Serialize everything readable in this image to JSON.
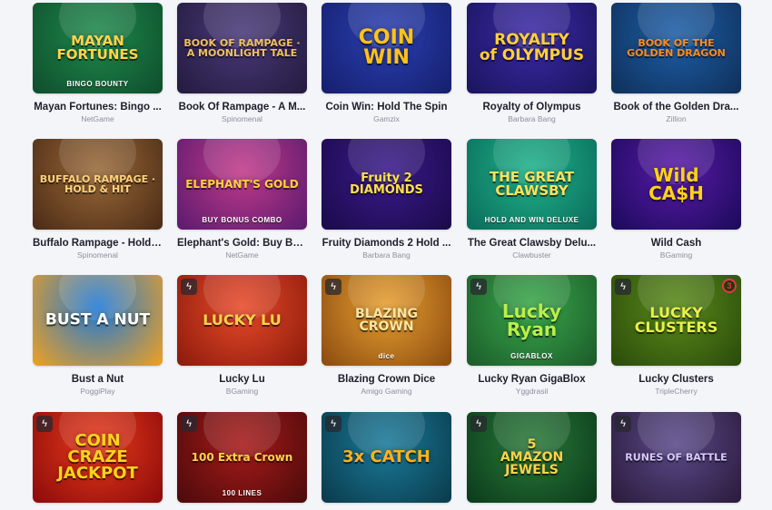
{
  "games": [
    {
      "name": "Mayan Fortunes: Bingo ...",
      "provider": "NetGame",
      "art_title": "MAYAN\nFORTUNES",
      "art_subtitle": "BINGO BOUNTY",
      "badge": false,
      "bg": [
        "#1f8a4c",
        "#0e4d2c"
      ],
      "title_color": "#ffd54a"
    },
    {
      "name": "Book Of Rampage - A M...",
      "provider": "Spinomenal",
      "art_title": "",
      "art_subtitle": "",
      "art_image_text": "BOOK OF RAMPAGE · A MOONLIGHT TALE",
      "badge": false,
      "bg": [
        "#4a3a7a",
        "#241a3e"
      ],
      "title_color": "#f0c060"
    },
    {
      "name": "Coin Win: Hold The Spin",
      "provider": "Gamzix",
      "art_title": "COIN\nWIN",
      "art_subtitle": "",
      "badge": false,
      "bg": [
        "#2a3fb0",
        "#151f6e"
      ],
      "title_color": "#ffc21a"
    },
    {
      "name": "Royalty of Olympus",
      "provider": "Barbara Bang",
      "art_title": "ROYALTY\nof OLYMPUS",
      "art_subtitle": "",
      "badge": false,
      "bg": [
        "#3b2aa8",
        "#1a145c"
      ],
      "title_color": "#ffcf3a"
    },
    {
      "name": "Book of the Golden Dra...",
      "provider": "Zillion",
      "art_title": "",
      "art_subtitle": "",
      "art_image_text": "BOOK OF THE GOLDEN DRAGON",
      "badge": false,
      "bg": [
        "#1d5fa8",
        "#0f2f5a"
      ],
      "title_color": "#ff8a1a"
    },
    {
      "name": "Buffalo Rampage - Hold ...",
      "provider": "Spinomenal",
      "art_title": "",
      "art_subtitle": "",
      "art_image_text": "BUFFALO RAMPAGE · HOLD & HIT",
      "badge": false,
      "bg": [
        "#9a6a3a",
        "#4a2a14"
      ],
      "title_color": "#ffd27a"
    },
    {
      "name": "Elephant's Gold: Buy Bo...",
      "provider": "NetGame",
      "art_title": "ELEPHANT'S GOLD",
      "art_subtitle": "BUY BONUS COMBO",
      "badge": false,
      "bg": [
        "#c23a8a",
        "#5a1a6e"
      ],
      "title_color": "#ffd23a"
    },
    {
      "name": "Fruity Diamonds 2 Hold ...",
      "provider": "Barbara Bang",
      "art_title": "Fruity 2\nDIAMONDS",
      "art_subtitle": "",
      "badge": false,
      "bg": [
        "#3a1a8a",
        "#1a0a4a"
      ],
      "title_color": "#ffe14a"
    },
    {
      "name": "The Great Clawsby Delu...",
      "provider": "Clawbuster",
      "art_title": "THE GREAT\nCLAWSBY",
      "art_subtitle": "HOLD AND WIN DELUXE",
      "badge": false,
      "bg": [
        "#1fb38a",
        "#0a6a5a"
      ],
      "title_color": "#ffe25a"
    },
    {
      "name": "Wild Cash",
      "provider": "BGaming",
      "art_title": "Wild\nCA$H",
      "art_subtitle": "",
      "badge": false,
      "bg": [
        "#5a1aa8",
        "#1a0a5a"
      ],
      "title_color": "#ffd21a"
    },
    {
      "name": "Bust a Nut",
      "provider": "PoggiPlay",
      "art_title": "BUST A NUT",
      "art_subtitle": "",
      "badge": false,
      "bg": [
        "#1f7ad8",
        "#f0a020"
      ],
      "title_color": "#ffffff"
    },
    {
      "name": "Lucky Lu",
      "provider": "BGaming",
      "art_title": "LUCKY LU",
      "art_subtitle": "",
      "badge": true,
      "bg": [
        "#e84a2a",
        "#8a1a0a"
      ],
      "title_color": "#ffd24a"
    },
    {
      "name": "Blazing Crown Dice",
      "provider": "Amigo Gaming",
      "art_title": "BLAZING\nCROWN",
      "art_subtitle": "dice",
      "badge": true,
      "bg": [
        "#e8a030",
        "#8a4a10"
      ],
      "title_color": "#ffe6a0"
    },
    {
      "name": "Lucky Ryan GigaBlox",
      "provider": "Yggdrasil",
      "art_title": "Lucky\nRyan",
      "art_subtitle": "GIGABLOX",
      "badge": true,
      "bg": [
        "#3aa84a",
        "#1a5a2a"
      ],
      "title_color": "#b8f04a"
    },
    {
      "name": "Lucky Clusters",
      "provider": "TripleCherry",
      "art_title": "LUCKY\nCLUSTERS",
      "art_subtitle": "",
      "badge": true,
      "corner": "3",
      "bg": [
        "#5a8a1a",
        "#2a4a0a"
      ],
      "title_color": "#e8f04a"
    },
    {
      "name": "",
      "provider": "",
      "art_title": "COIN\nCRAZE\nJACKPOT",
      "art_subtitle": "",
      "badge": true,
      "bg": [
        "#e83a1a",
        "#8a0a0a"
      ],
      "title_color": "#ffd21a"
    },
    {
      "name": "",
      "provider": "",
      "art_title": "100 Extra Crown",
      "art_subtitle": "100 LINES",
      "badge": true,
      "bg": [
        "#a81a1a",
        "#4a0a0a"
      ],
      "title_color": "#ffd24a"
    },
    {
      "name": "",
      "provider": "",
      "art_title": "3x CATCH",
      "art_subtitle": "",
      "badge": true,
      "bg": [
        "#1a7a9a",
        "#0a3a4a"
      ],
      "title_color": "#ffb21a"
    },
    {
      "name": "",
      "provider": "",
      "art_title": "5\nAMAZON\nJEWELS",
      "art_subtitle": "",
      "badge": true,
      "bg": [
        "#2a7a3a",
        "#0a3a1a"
      ],
      "title_color": "#ffd24a"
    },
    {
      "name": "",
      "provider": "",
      "art_title": "",
      "art_subtitle": "",
      "art_image_text": "RUNES OF BATTLE",
      "badge": true,
      "bg": [
        "#5a4a8a",
        "#2a1a3a"
      ],
      "title_color": "#d8c8ff"
    }
  ],
  "icons": {
    "badge": "lightning-icon",
    "badge_glyph": "ϟ"
  }
}
